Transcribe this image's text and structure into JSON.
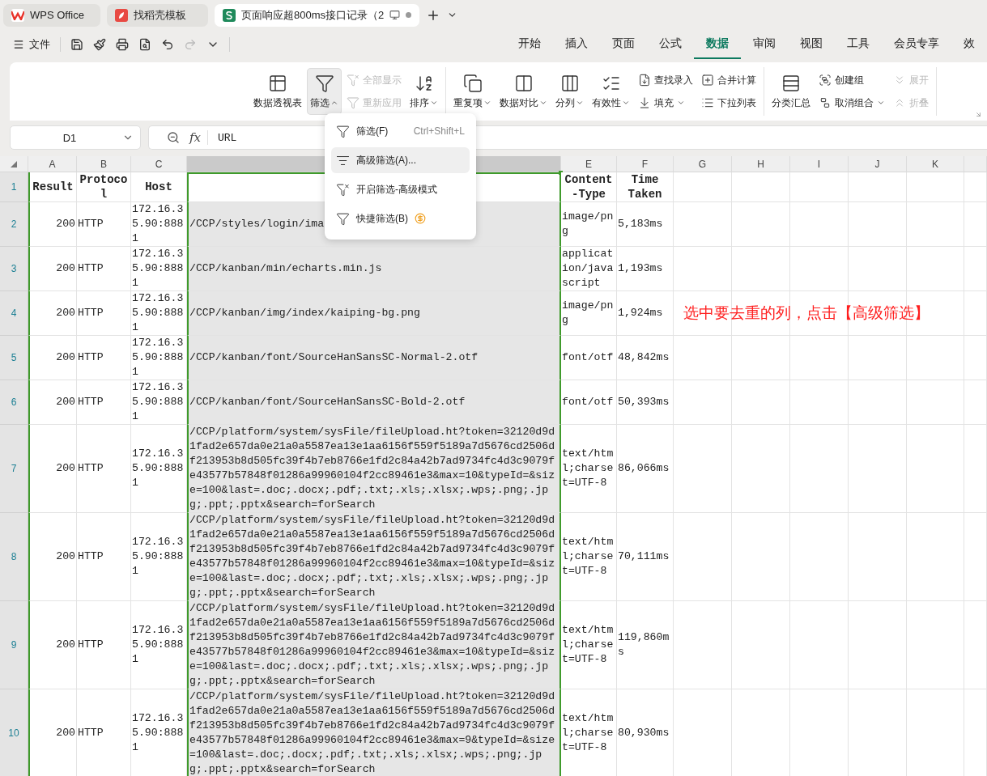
{
  "title_tabs": [
    {
      "label": "WPS Office",
      "selected": false
    },
    {
      "label": "找稻壳模板",
      "selected": false
    },
    {
      "label": "页面响应超800ms接口记录（2",
      "selected": true
    }
  ],
  "quick_menu": {
    "label": "文件"
  },
  "menu_tabs": [
    {
      "label": "开始",
      "selected": false
    },
    {
      "label": "插入",
      "selected": false
    },
    {
      "label": "页面",
      "selected": false
    },
    {
      "label": "公式",
      "selected": false
    },
    {
      "label": "数据",
      "selected": true
    },
    {
      "label": "审阅",
      "selected": false
    },
    {
      "label": "视图",
      "selected": false
    },
    {
      "label": "工具",
      "selected": false
    },
    {
      "label": "会员专享",
      "selected": false
    },
    {
      "label": "效",
      "selected": false
    }
  ],
  "ribbon": {
    "groups": [
      {
        "items": [
          {
            "kind": "large",
            "label": "数据透视表",
            "disabled": false,
            "dropdown": false,
            "open": false
          },
          {
            "kind": "large",
            "label": "筛选",
            "disabled": false,
            "dropdown": true,
            "open": true
          },
          {
            "kind": "stack",
            "items": [
              {
                "label": "全部显示",
                "disabled": true,
                "dropdown": false
              },
              {
                "label": "重新应用",
                "disabled": true,
                "dropdown": false
              }
            ]
          },
          {
            "kind": "large",
            "label": "排序",
            "disabled": false,
            "dropdown": true,
            "open": false
          }
        ]
      },
      {
        "items": [
          {
            "kind": "large",
            "label": "重复项",
            "disabled": false,
            "dropdown": true,
            "open": false
          },
          {
            "kind": "large",
            "label": "数据对比",
            "disabled": false,
            "dropdown": true,
            "open": false
          },
          {
            "kind": "large",
            "label": "分列",
            "disabled": false,
            "dropdown": true,
            "open": false
          },
          {
            "kind": "large",
            "label": "有效性",
            "disabled": false,
            "dropdown": true,
            "open": false
          },
          {
            "kind": "stack",
            "items": [
              {
                "label": "查找录入",
                "disabled": false,
                "dropdown": false
              },
              {
                "label": "填充",
                "disabled": false,
                "dropdown": true
              }
            ]
          },
          {
            "kind": "stack",
            "items": [
              {
                "label": "合并计算",
                "disabled": false,
                "dropdown": false
              },
              {
                "label": "下拉列表",
                "disabled": false,
                "dropdown": false
              }
            ]
          }
        ]
      },
      {
        "items": [
          {
            "kind": "large",
            "label": "分类汇总",
            "disabled": false,
            "dropdown": false,
            "open": false
          },
          {
            "kind": "stack",
            "items": [
              {
                "label": "创建组",
                "disabled": false,
                "dropdown": false
              },
              {
                "label": "取消组合",
                "disabled": false,
                "dropdown": true
              }
            ]
          },
          {
            "kind": "stack",
            "items": [
              {
                "label": "展开",
                "disabled": true,
                "dropdown": false
              },
              {
                "label": "折叠",
                "disabled": true,
                "dropdown": false
              }
            ]
          }
        ]
      }
    ]
  },
  "formula_bar": {
    "cell": "D1",
    "fx": "fx",
    "value": "URL"
  },
  "filter_menu": [
    {
      "label": "筛选(F)",
      "shortcut": "Ctrl+Shift+L",
      "selected": false,
      "premium": false
    },
    {
      "label": "高级筛选(A)...",
      "selected": true,
      "premium": false
    },
    {
      "label": "开启筛选-高级模式",
      "selected": false,
      "premium": false
    },
    {
      "label": "快捷筛选(B)",
      "selected": false,
      "premium": true
    }
  ],
  "sheet": {
    "columns": [
      {
        "label": "A",
        "selected": false
      },
      {
        "label": "B",
        "selected": false
      },
      {
        "label": "C",
        "selected": false
      },
      {
        "selected": true
      },
      {
        "label": "E",
        "selected": false
      },
      {
        "label": "F",
        "selected": false
      },
      {
        "label": "G",
        "selected": false
      },
      {
        "label": "H",
        "selected": false
      },
      {
        "label": "I",
        "selected": false
      },
      {
        "label": "J",
        "selected": false
      },
      {
        "label": "K",
        "selected": false
      }
    ],
    "header": {
      "number": "1",
      "result": "Result",
      "protocol": "Protocol",
      "host": "Host",
      "content_type": "Content-Type",
      "time_taken": "Time Taken"
    },
    "rows": [
      {
        "number": "2",
        "result": "200",
        "protocol": "HTTP",
        "host": "172.16.35.90:8881",
        "url": "/CCP/styles/login/ima",
        "content_type": "image/png",
        "time_taken": "5,183ms"
      },
      {
        "number": "3",
        "result": "200",
        "protocol": "HTTP",
        "host": "172.16.35.90:8881",
        "url": "/CCP/kanban/min/echarts.min.js",
        "content_type": "application/javascript",
        "time_taken": "1,193ms"
      },
      {
        "number": "4",
        "result": "200",
        "protocol": "HTTP",
        "host": "172.16.35.90:8881",
        "url": "/CCP/kanban/img/index/kaiping-bg.png",
        "content_type": "image/png",
        "time_taken": "1,924ms",
        "note": "选中要去重的列，点击【高级筛选】"
      },
      {
        "number": "5",
        "result": "200",
        "protocol": "HTTP",
        "host": "172.16.35.90:8881",
        "url": "/CCP/kanban/font/SourceHanSansSC-Normal-2.otf",
        "content_type": "font/otf",
        "time_taken": "48,842ms"
      },
      {
        "number": "6",
        "result": "200",
        "protocol": "HTTP",
        "host": "172.16.35.90:8881",
        "url": "/CCP/kanban/font/SourceHanSansSC-Bold-2.otf",
        "content_type": "font/otf",
        "time_taken": "50,393ms"
      },
      {
        "number": "7",
        "result": "200",
        "protocol": "HTTP",
        "host": "172.16.35.90:8881",
        "url": "/CCP/platform/system/sysFile/fileUpload.ht?token=32120d9d1fad2e657da0e21a0a5587ea13e1aa6156f559f5189a7d5676cd2506df213953b8d505fc39f4b7eb8766e1fd2c84a42b7ad9734fc4d3c9079fe43577b57848f01286a99960104f2cc89461e3&max=10&typeId=&size=100&last=.doc;.docx;.pdf;.txt;.xls;.xlsx;.wps;.png;.jpg;.ppt;.pptx&search=forSearch",
        "content_type": "text/html;charset=UTF-8",
        "time_taken": "86,066ms"
      },
      {
        "number": "8",
        "result": "200",
        "protocol": "HTTP",
        "host": "172.16.35.90:8881",
        "url": "/CCP/platform/system/sysFile/fileUpload.ht?token=32120d9d1fad2e657da0e21a0a5587ea13e1aa6156f559f5189a7d5676cd2506df213953b8d505fc39f4b7eb8766e1fd2c84a42b7ad9734fc4d3c9079fe43577b57848f01286a99960104f2cc89461e3&max=10&typeId=&size=100&last=.doc;.docx;.pdf;.txt;.xls;.xlsx;.wps;.png;.jpg;.ppt;.pptx&search=forSearch",
        "content_type": "text/html;charset=UTF-8",
        "time_taken": "70,111ms"
      },
      {
        "number": "9",
        "result": "200",
        "protocol": "HTTP",
        "host": "172.16.35.90:8881",
        "url": "/CCP/platform/system/sysFile/fileUpload.ht?token=32120d9d1fad2e657da0e21a0a5587ea13e1aa6156f559f5189a7d5676cd2506df213953b8d505fc39f4b7eb8766e1fd2c84a42b7ad9734fc4d3c9079fe43577b57848f01286a99960104f2cc89461e3&max=10&typeId=&size=100&last=.doc;.docx;.pdf;.txt;.xls;.xlsx;.wps;.png;.jpg;.ppt;.pptx&search=forSearch",
        "content_type": "text/html;charset=UTF-8",
        "time_taken": "119,860ms"
      },
      {
        "number": "10",
        "result": "200",
        "protocol": "HTTP",
        "host": "172.16.35.90:8881",
        "url": "/CCP/platform/system/sysFile/fileUpload.ht?token=32120d9d1fad2e657da0e21a0a5587ea13e1aa6156f559f5189a7d5676cd2506df213953b8d505fc39f4b7eb8766e1fd2c84a42b7ad9734fc4d3c9079fe43577b57848f01286a99960104f2cc89461e3&max=9&typeId=&size=100&last=.doc;.docx;.pdf;.txt;.xls;.xlsx;.wps;.png;.jpg;.ppt;.pptx&search=forSearch",
        "content_type": "text/html;charset=UTF-8",
        "time_taken": "80,930ms"
      }
    ]
  }
}
